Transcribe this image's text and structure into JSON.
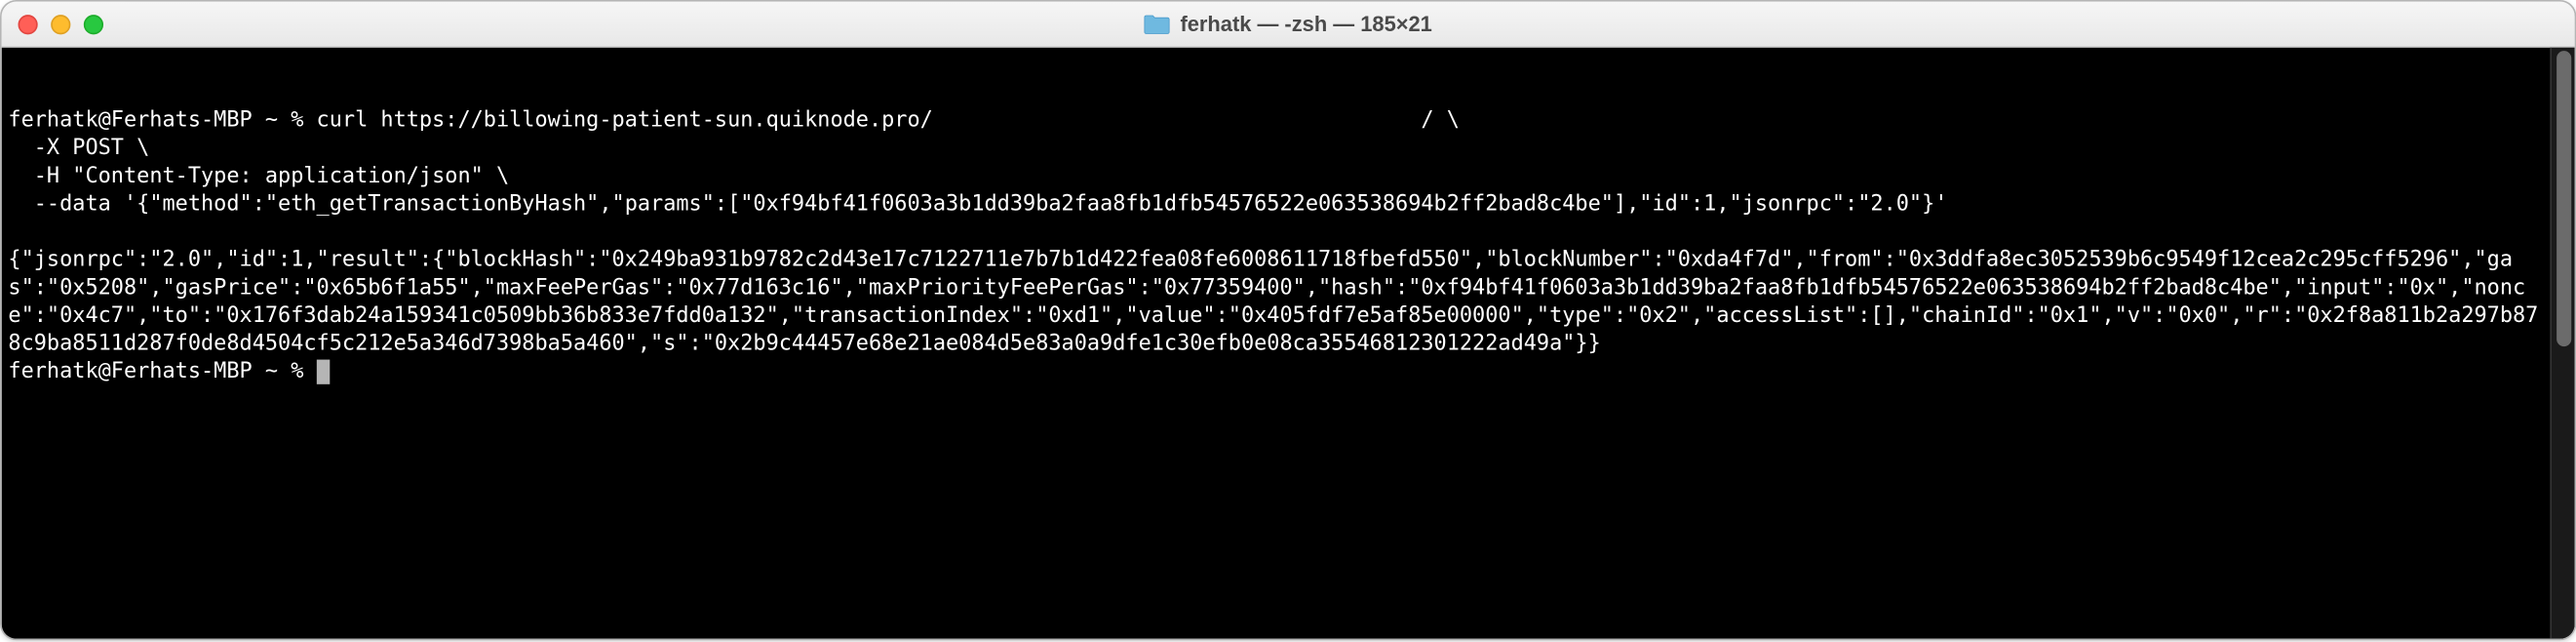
{
  "window": {
    "title": "ferhatk — -zsh — 185×21"
  },
  "prompt": "ferhatk@Ferhats-MBP ~ % ",
  "command": {
    "line1_prefix": "curl https://billowing-patient-sun.quiknode.pro/",
    "line1_redacted": "                                      ",
    "line1_suffix": "/ \\",
    "line2": "  -X POST \\",
    "line3": "  -H \"Content-Type: application/json\" \\",
    "line4": "  --data '{\"method\":\"eth_getTransactionByHash\",\"params\":[\"0xf94bf41f0603a3b1dd39ba2faa8fb1dfb54576522e063538694b2ff2bad8c4be\"],\"id\":1,\"jsonrpc\":\"2.0\"}'"
  },
  "response": "{\"jsonrpc\":\"2.0\",\"id\":1,\"result\":{\"blockHash\":\"0x249ba931b9782c2d43e17c7122711e7b7b1d422fea08fe6008611718fbefd550\",\"blockNumber\":\"0xda4f7d\",\"from\":\"0x3ddfa8ec3052539b6c9549f12cea2c295cff5296\",\"gas\":\"0x5208\",\"gasPrice\":\"0x65b6f1a55\",\"maxFeePerGas\":\"0x77d163c16\",\"maxPriorityFeePerGas\":\"0x77359400\",\"hash\":\"0xf94bf41f0603a3b1dd39ba2faa8fb1dfb54576522e063538694b2ff2bad8c4be\",\"input\":\"0x\",\"nonce\":\"0x4c7\",\"to\":\"0x176f3dab24a159341c0509bb36b833e7fdd0a132\",\"transactionIndex\":\"0xd1\",\"value\":\"0x405fdf7e5af85e00000\",\"type\":\"0x2\",\"accessList\":[],\"chainId\":\"0x1\",\"v\":\"0x0\",\"r\":\"0x2f8a811b2a297b878c9ba8511d287f0de8d4504cf5c212e5a346d7398ba5a460\",\"s\":\"0x2b9c44457e68e21ae084d5e83a0a9dfe1c30efb0e08ca35546812301222ad49a\"}}"
}
